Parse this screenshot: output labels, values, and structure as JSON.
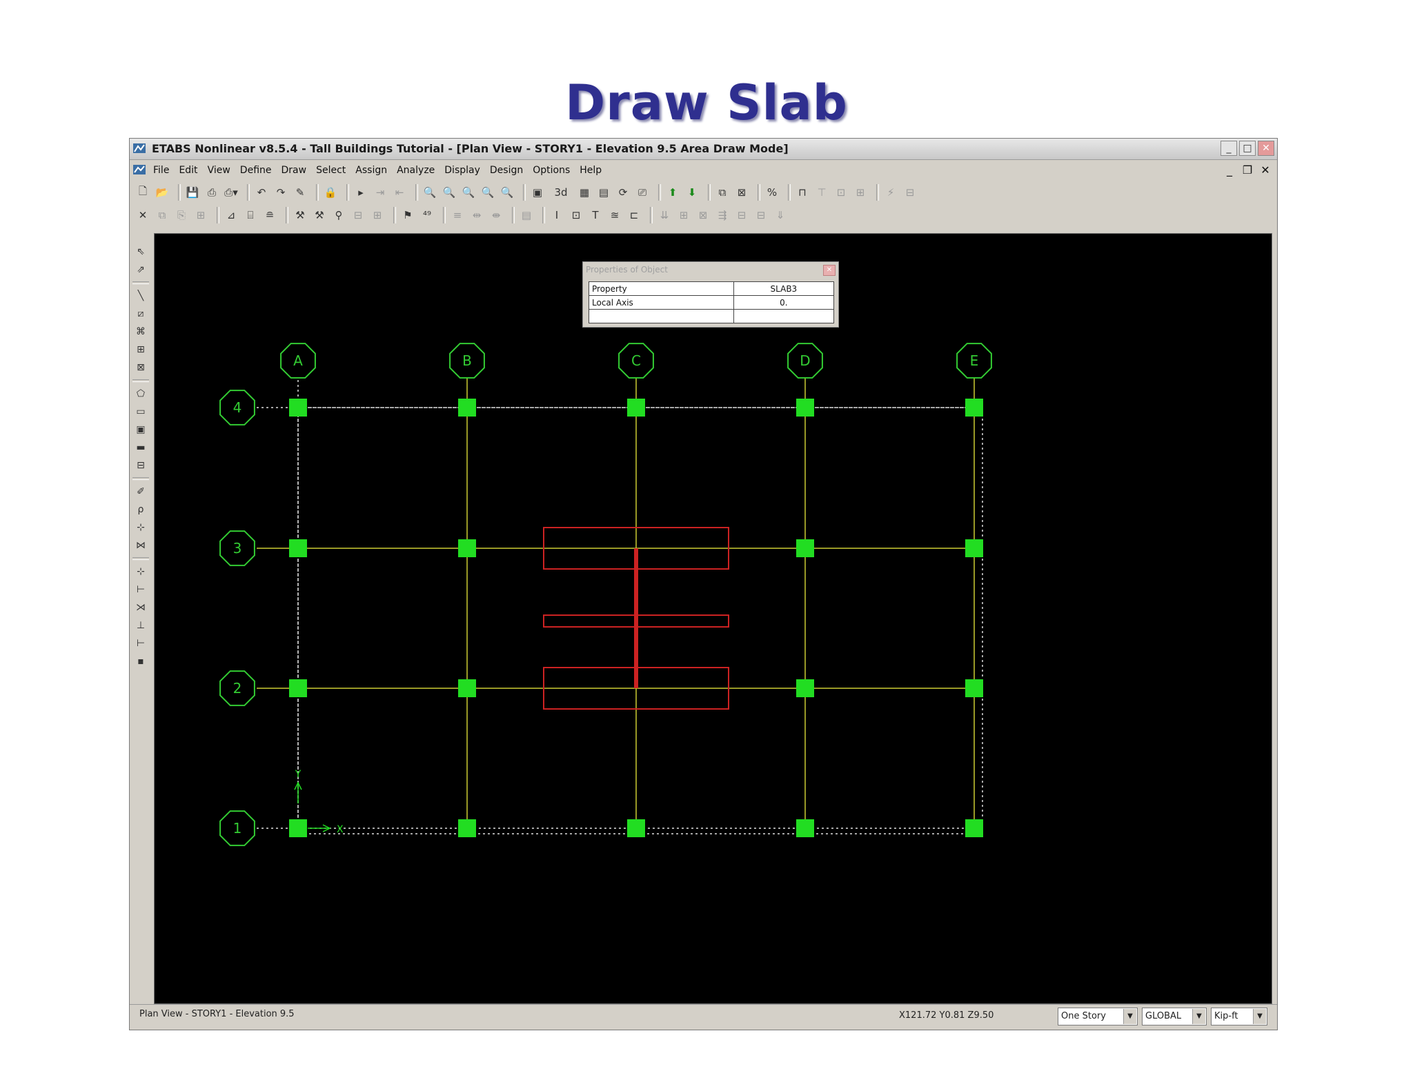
{
  "slide": {
    "title": "Draw Slab"
  },
  "window": {
    "title": "ETABS Nonlinear v8.5.4 - Tall Buildings Tutorial - [Plan View - STORY1 - Elevation 9.5  Area Draw Mode]"
  },
  "menu": [
    "File",
    "Edit",
    "View",
    "Define",
    "Draw",
    "Select",
    "Assign",
    "Analyze",
    "Display",
    "Design",
    "Options",
    "Help"
  ],
  "toolbar": {
    "view_3d_label": "3d"
  },
  "properties_popup": {
    "title": "Properties of Object",
    "rows": [
      {
        "label": "Property",
        "value": "SLAB3"
      },
      {
        "label": "Local Axis",
        "value": "0."
      }
    ]
  },
  "grid": {
    "columns": [
      "A",
      "B",
      "C",
      "D",
      "E"
    ],
    "rows": [
      "4",
      "3",
      "2",
      "1"
    ],
    "axis_x_label": "X",
    "axis_y_label": "Y"
  },
  "colors": {
    "canvas_bg": "#000000",
    "grid_line": "#cccc33",
    "joint": "#22dd22",
    "bubble": "#33cc33",
    "selection_box": "#cc2222",
    "boundary": "#e0e0e0",
    "title": "#2f2f8f"
  },
  "statusbar": {
    "view_label": "Plan View - STORY1 - Elevation 9.5",
    "coordinates": "X121.72  Y0.81  Z9.50",
    "story_select": "One Story",
    "coord_system": "GLOBAL",
    "units": "Kip-ft"
  }
}
